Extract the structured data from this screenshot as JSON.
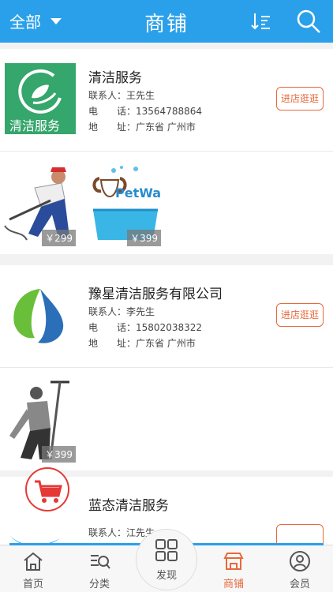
{
  "header": {
    "filter_label": "全部",
    "title": "商铺"
  },
  "shops": [
    {
      "name": "清洁服务",
      "logo_text": "清洁服务",
      "contact_label": "联系人：",
      "contact": "王先生",
      "phone_label": "电　　话：",
      "phone": "13564788864",
      "address_label": "地　　址：",
      "address": "广东省 广州市",
      "enter_label": "进店逛逛",
      "products": [
        {
          "price": "￥299",
          "icon": "worker-pressure-washer-icon"
        },
        {
          "price": "￥399",
          "icon": "petwash-icon",
          "brand": "PetWash"
        }
      ]
    },
    {
      "name": "豫星清洁服务有限公司",
      "contact_label": "联系人：",
      "contact": "李先生",
      "phone_label": "电　　话：",
      "phone": "15802038322",
      "address_label": "地　　址：",
      "address": "广东省 广州市",
      "enter_label": "进店逛逛",
      "products": [
        {
          "price": "￥399",
          "icon": "window-cleaner-icon"
        }
      ]
    },
    {
      "name": "蓝态清洁服务",
      "contact_label": "联系人：",
      "contact": "江先生"
    }
  ],
  "nav": {
    "items": [
      {
        "label": "首页",
        "icon": "home-icon"
      },
      {
        "label": "分类",
        "icon": "category-icon"
      },
      {
        "label": "发现",
        "icon": "discover-icon"
      },
      {
        "label": "商铺",
        "icon": "shop-icon"
      },
      {
        "label": "会员",
        "icon": "member-icon"
      }
    ],
    "active_color": "#e8693c"
  },
  "colors": {
    "accent": "#2aa0ea",
    "button": "#e8693c"
  }
}
